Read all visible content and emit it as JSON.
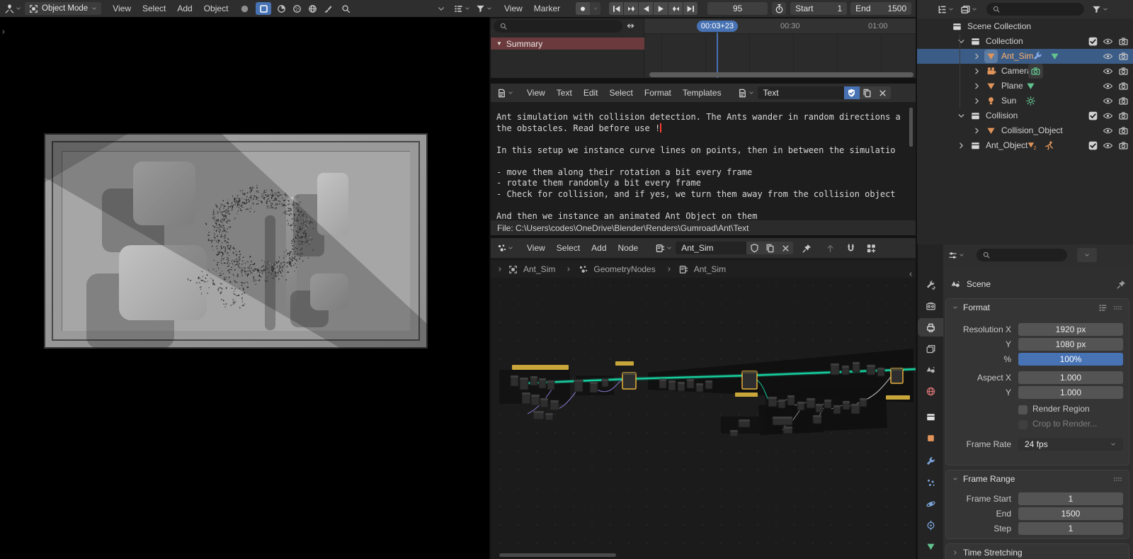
{
  "viewport": {
    "mode_label": "Object Mode",
    "menus": [
      "View",
      "Select",
      "Add",
      "Object"
    ]
  },
  "timeline": {
    "menus": [
      "View",
      "Marker"
    ],
    "frame_current": "95",
    "start_label": "Start",
    "start_value": "1",
    "end_label": "End",
    "end_value": "1500",
    "playhead": "00:03+23",
    "ticks": [
      "00:30",
      "01:00"
    ],
    "channel_summary": "Summary"
  },
  "text_editor": {
    "menus": [
      "View",
      "Text",
      "Edit",
      "Select",
      "Format",
      "Templates"
    ],
    "datablock": "Text",
    "lines": [
      "Ant simulation with collision detection. The Ants wander in random directions a",
      "the obstacles. Read before use !",
      "",
      "In this setup we instance curve lines on points, then in between the simulatio",
      "",
      "- move them along their rotation a bit every frame",
      "- rotate them randomly a bit every frame",
      "- Check for collision, and if yes, we turn them away from the collision object",
      "",
      "And then we instance an animated Ant_Object on them"
    ],
    "footer": "File: C:\\Users\\codes\\OneDrive\\Blender\\Renders\\Gumroad\\Ant\\Text"
  },
  "node_editor": {
    "menus": [
      "View",
      "Select",
      "Add",
      "Node"
    ],
    "datablock": "Ant_Sim",
    "breadcrumb": [
      "Ant_Sim",
      "GeometryNodes",
      "Ant_Sim"
    ]
  },
  "outliner": {
    "labels": [
      "Scene Collection",
      "Collection",
      "Ant_Sim",
      "Camera",
      "Plane",
      "Sun",
      "Collision",
      "Collision_Object",
      "Ant_Object"
    ]
  },
  "properties": {
    "breadcrumb": "Scene",
    "format": {
      "title": "Format",
      "rows": [
        {
          "label": "Resolution X",
          "value": "1920 px"
        },
        {
          "label": "Y",
          "value": "1080 px"
        },
        {
          "label": "%",
          "value": "100%"
        },
        {
          "label": "Aspect X",
          "value": "1.000"
        },
        {
          "label": "Y",
          "value": "1.000"
        }
      ],
      "render_region": "Render Region",
      "crop": "Crop to Render...",
      "frame_rate_label": "Frame Rate",
      "frame_rate": "24 fps"
    },
    "frame_range": {
      "title": "Frame Range",
      "rows": [
        {
          "label": "Frame Start",
          "value": "1"
        },
        {
          "label": "End",
          "value": "1500"
        },
        {
          "label": "Step",
          "value": "1"
        }
      ]
    },
    "time_stretching": "Time Stretching"
  },
  "colors": {
    "accent_blue": "#4772b3",
    "selection_blue": "#3b5c87",
    "object_orange": "#e0945a",
    "data_green": "#62c28e",
    "wire_teal": "#18cf9f",
    "summary_red": "#6a3a3c"
  }
}
